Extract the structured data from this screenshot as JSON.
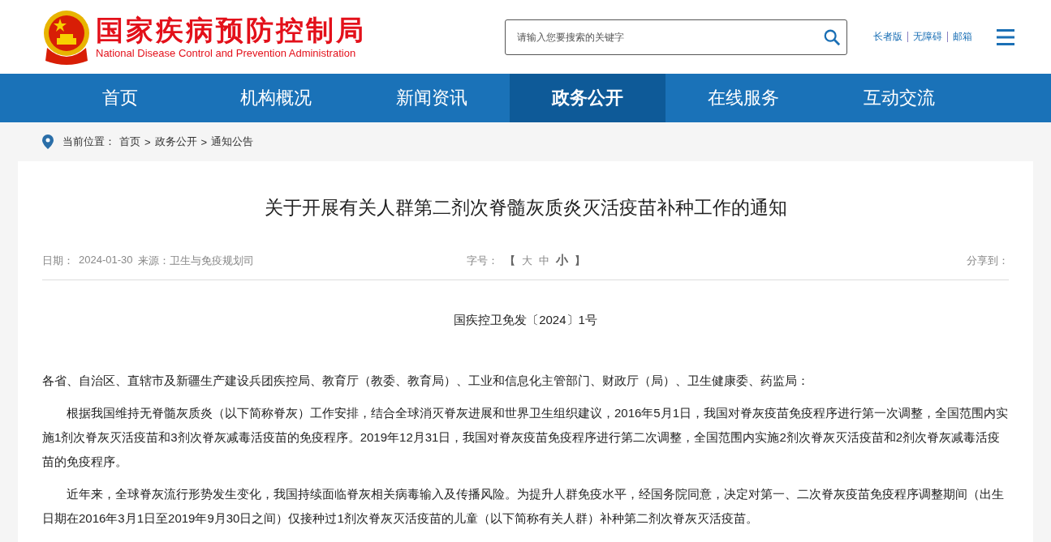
{
  "header": {
    "title_cn": "国家疾病预防控制局",
    "title_en": "National Disease Control and Prevention Administration",
    "search": {
      "placeholder": "请输入您要搜索的关键字"
    },
    "links": [
      "长者版",
      "无障碍",
      "邮箱"
    ]
  },
  "nav": [
    {
      "label": "首页",
      "selected": false
    },
    {
      "label": "机构概况",
      "selected": false
    },
    {
      "label": "新闻资讯",
      "selected": false
    },
    {
      "label": "政务公开",
      "selected": true
    },
    {
      "label": "在线服务",
      "selected": false
    },
    {
      "label": "互动交流",
      "selected": false
    }
  ],
  "breadcrumb": {
    "label": "当前位置：",
    "items": [
      "首页",
      "政务公开",
      "通知公告"
    ],
    "separator": ">"
  },
  "article": {
    "title": "关于开展有关人群第二剂次脊髓灰质炎灭活疫苗补种工作的通知",
    "meta": {
      "date_label": "日期：",
      "date": "2024-01-30",
      "source": "来源：卫生与免疫规划司"
    },
    "font_size": {
      "label": "字号：",
      "open": "【",
      "close": "】",
      "options": [
        {
          "label": "大",
          "selected": false
        },
        {
          "label": "中",
          "selected": false
        },
        {
          "label": "小",
          "selected": true
        }
      ]
    },
    "share": "分享到：",
    "doc_number": "国疾控卫免发〔2024〕1号",
    "paragraphs": [
      {
        "kind": "salutation",
        "text": "各省、自治区、直辖市及新疆生产建设兵团疾控局、教育厅（教委、教育局）、工业和信息化主管部门、财政厅（局）、卫生健康委、药监局："
      },
      {
        "kind": "body",
        "text": "根据我国维持无脊髓灰质炎（以下简称脊灰）工作安排，结合全球消灭脊灰进展和世界卫生组织建议，2016年5月1日，我国对脊灰疫苗免疫程序进行第一次调整，全国范围内实施1剂次脊灰灭活疫苗和3剂次脊灰减毒活疫苗的免疫程序。2019年12月31日，我国对脊灰疫苗免疫程序进行第二次调整，全国范围内实施2剂次脊灰灭活疫苗和2剂次脊灰减毒活疫苗的免疫程序。"
      },
      {
        "kind": "body",
        "text": "近年来，全球脊灰流行形势发生变化，我国持续面临脊灰相关病毒输入及传播风险。为提升人群免疫水平，经国务院同意，决定对第一、二次脊灰疫苗免疫程序调整期间（出生日期在2016年3月1日至2019年9月30日之间）仅接种过1剂次脊灰灭活疫苗的儿童（以下简称有关人群）补种第二剂次脊灰灭活疫苗。"
      }
    ]
  }
}
